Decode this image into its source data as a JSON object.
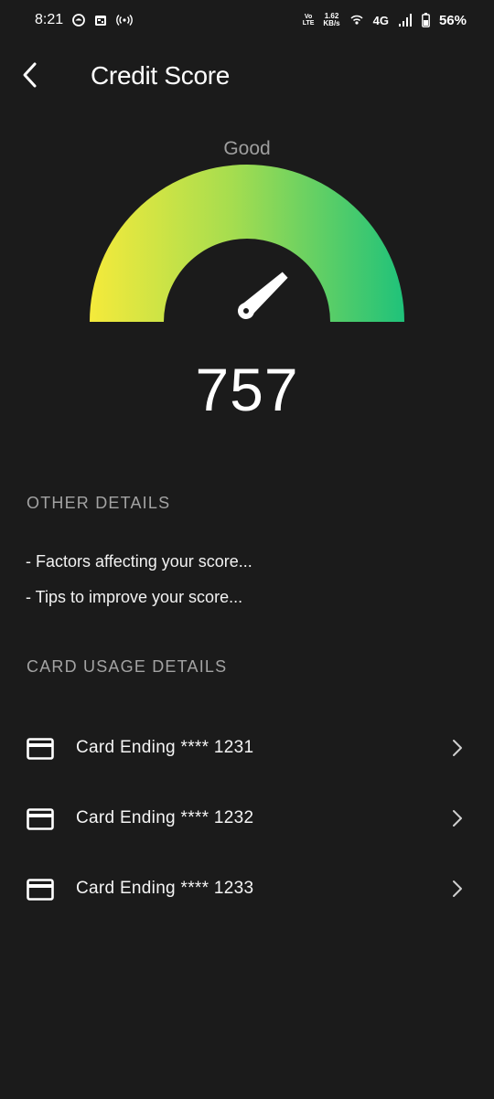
{
  "status_bar": {
    "time": "8:21",
    "net_speed_value": "1.62",
    "net_speed_unit": "KB/s",
    "volte_top": "Vo",
    "volte_bottom": "LTE",
    "network_type": "4G",
    "battery": "56%"
  },
  "header": {
    "title": "Credit Score",
    "back_icon": "chevron-left-icon"
  },
  "gauge": {
    "rating": "Good",
    "score": "757",
    "min": 300,
    "max": 900,
    "value": 757,
    "colors": {
      "start": "#f5ea3b",
      "mid": "#a6dd4f",
      "end": "#1fc27a"
    }
  },
  "other_details": {
    "title": "OTHER DETAILS",
    "items": [
      "- Factors affecting your score...",
      "- Tips to improve your score..."
    ]
  },
  "card_usage": {
    "title": "CARD USAGE DETAILS",
    "cards": [
      {
        "label": "Card Ending **** 1231"
      },
      {
        "label": "Card Ending **** 1232"
      },
      {
        "label": "Card Ending **** 1233"
      }
    ]
  },
  "theme": {
    "background": "#1b1b1b",
    "text": "#ffffff",
    "muted": "#a3a3a3"
  }
}
